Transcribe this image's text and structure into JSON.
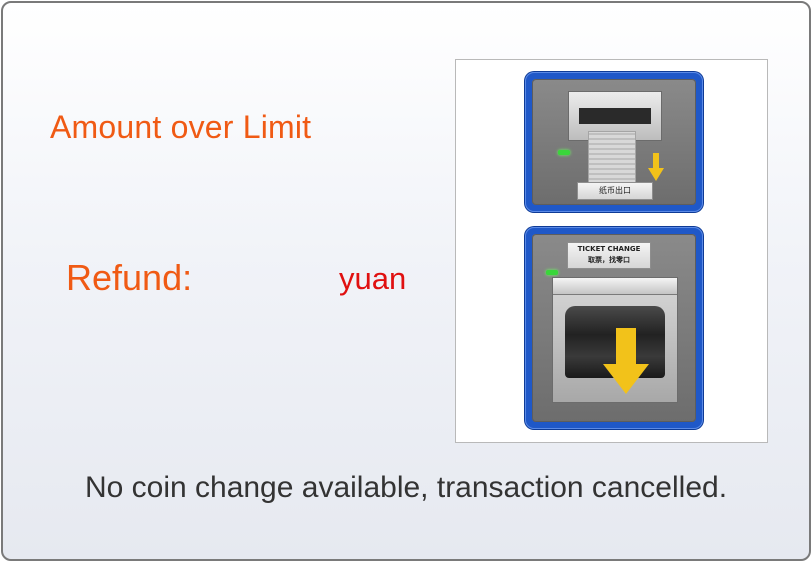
{
  "dialog": {
    "title": "Amount over Limit",
    "refund_label": "Refund:",
    "refund_unit": "yuan",
    "message": "No coin change available, transaction cancelled."
  },
  "illustration": {
    "top_panel": {
      "plate_text": "纸币出口"
    },
    "bottom_panel": {
      "plate_line1": "TICKET CHANGE",
      "plate_line2": "取票，找零口"
    }
  },
  "colors": {
    "title": "#f05a14",
    "refund_label": "#f05a14",
    "refund_unit": "#e01010",
    "message": "#333333",
    "panel_blue": "#1f58c8",
    "arrow_yellow": "#f2c21a",
    "led_green": "#39d63a"
  }
}
